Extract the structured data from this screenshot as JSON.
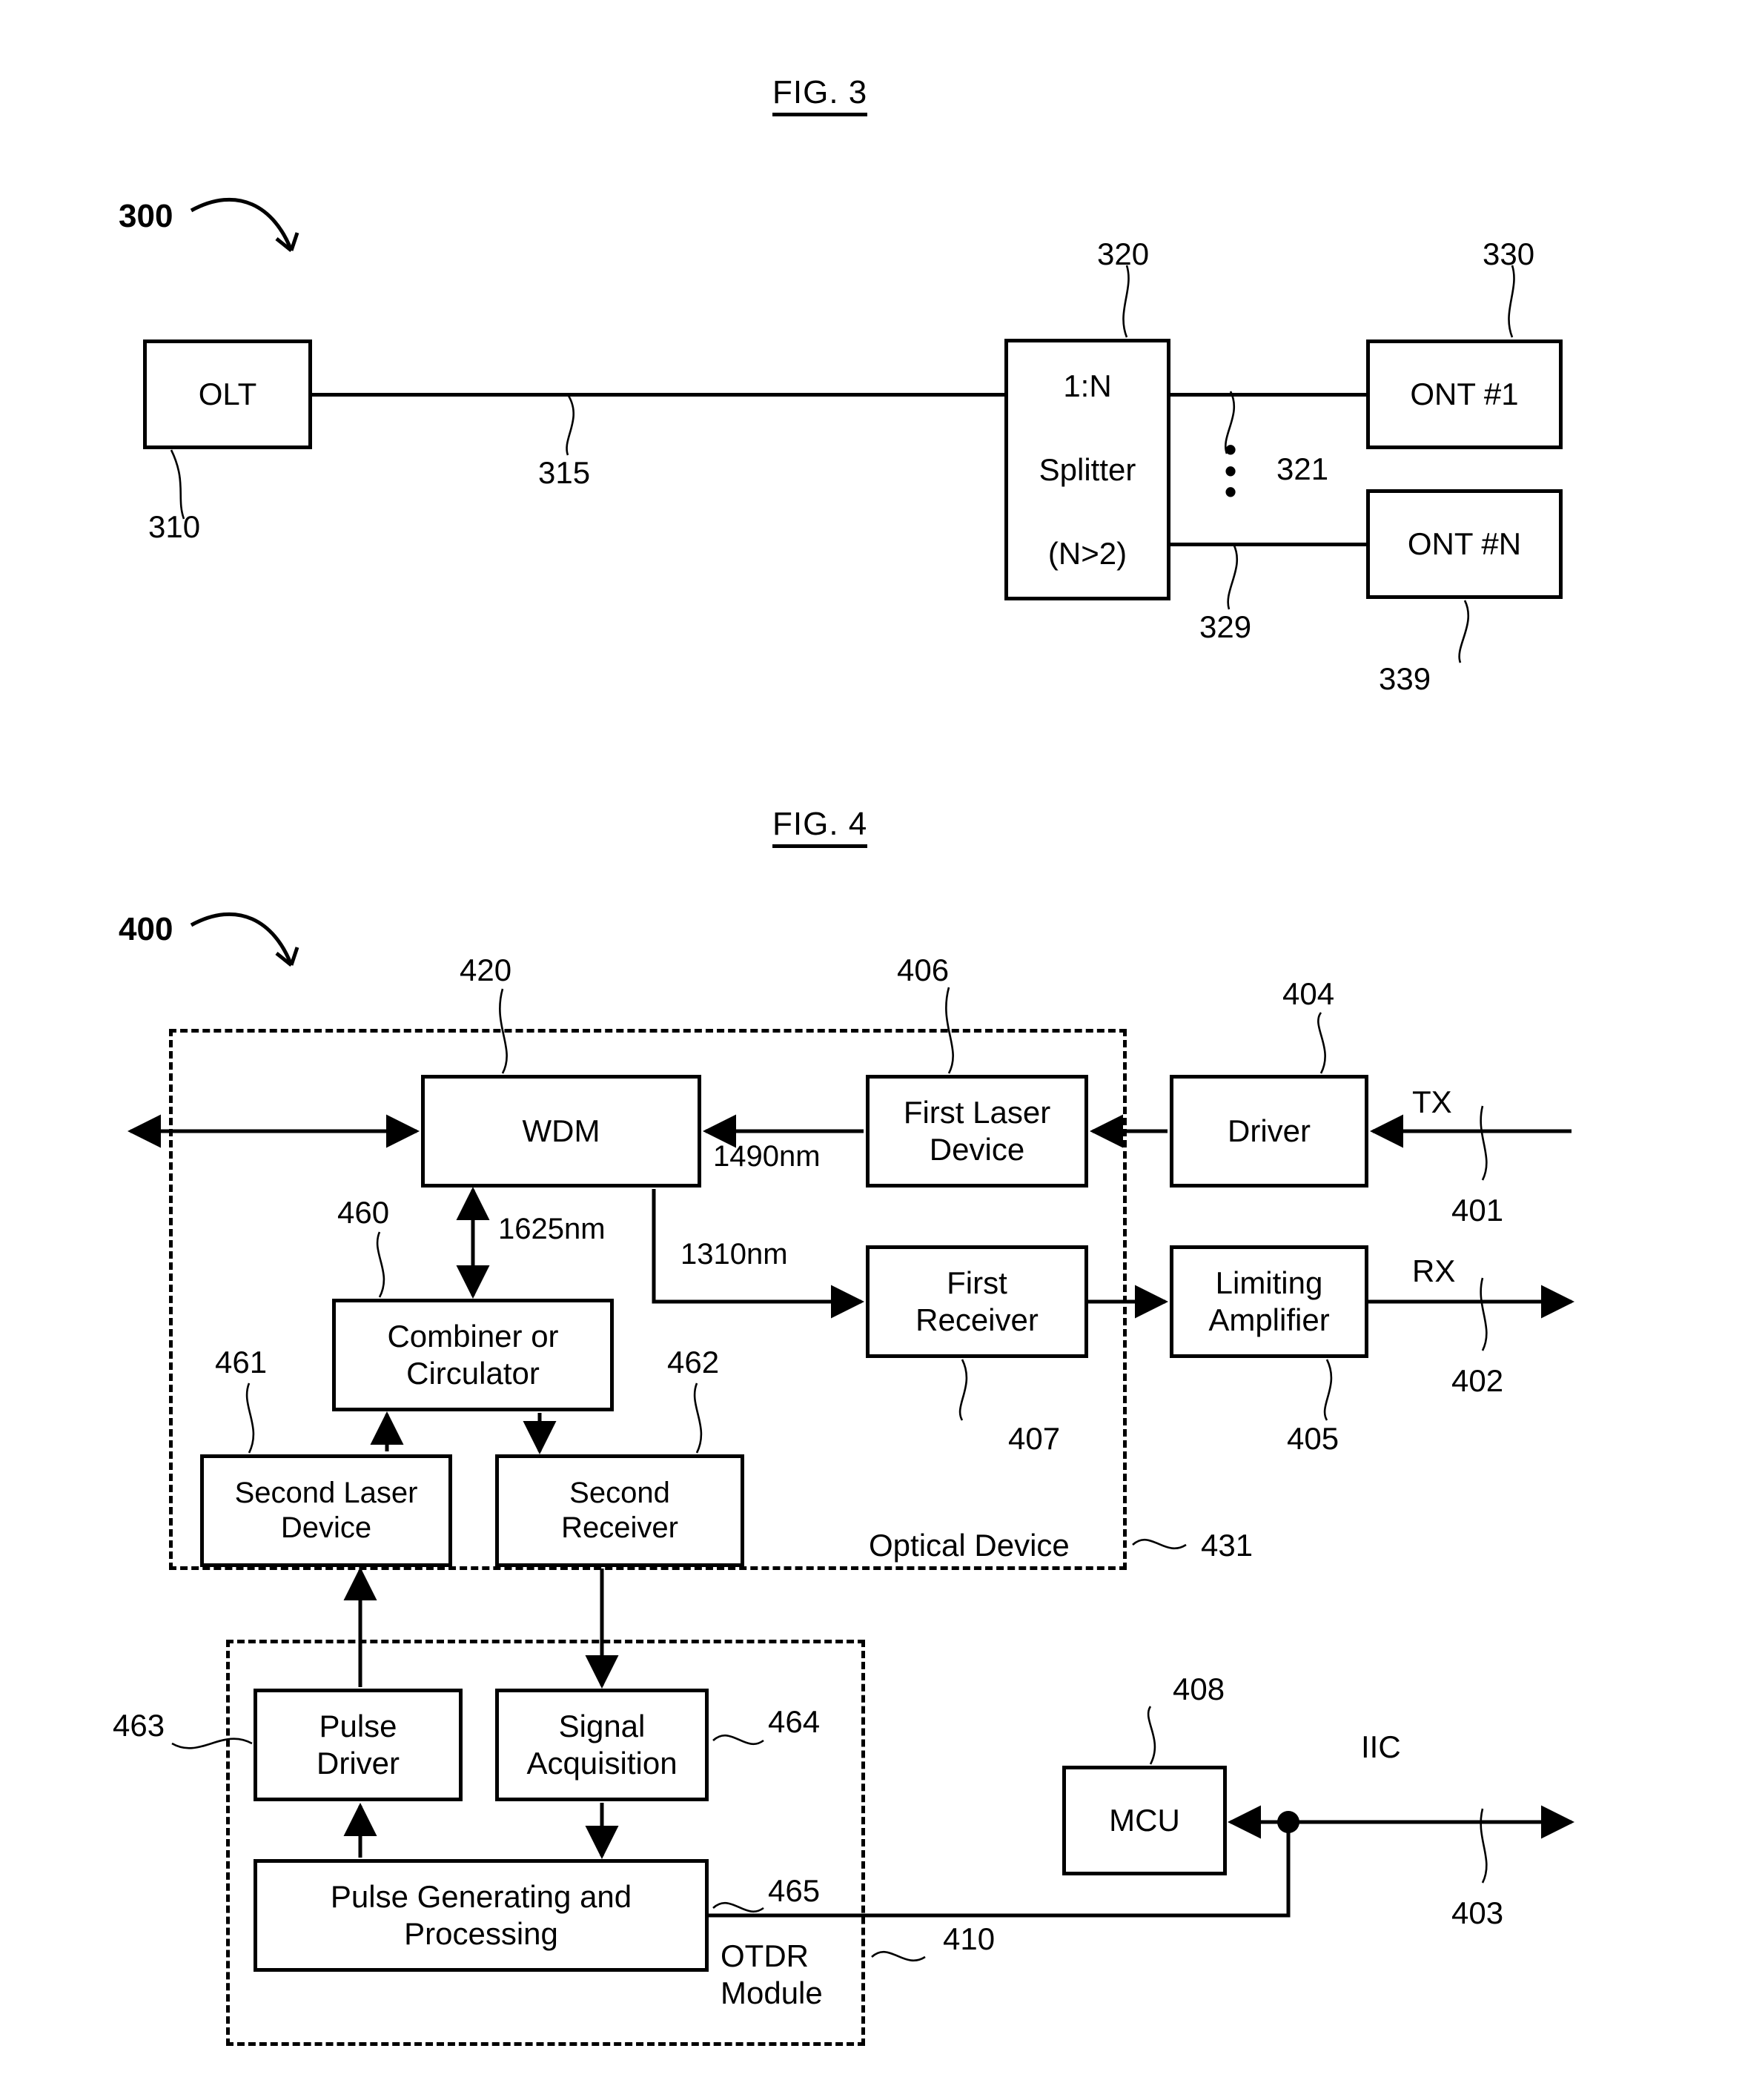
{
  "figures": [
    {
      "title": "FIG. 3",
      "callout": "300",
      "nodes": {
        "olt": "OLT",
        "splitter_line1": "1:N",
        "splitter_line2": "Splitter",
        "splitter_line3": "(N>2)",
        "ont_first": "ONT #1",
        "ont_last": "ONT #N"
      },
      "refs": {
        "system": "300",
        "olt": "310",
        "feeder_fiber": "315",
        "splitter": "320",
        "drop_fiber_first": "321",
        "drop_fiber_last": "329",
        "ont_first": "330",
        "ont_last": "339"
      }
    },
    {
      "title": "FIG. 4",
      "callout": "400",
      "nodes": {
        "wdm": "WDM",
        "first_laser_device": "First Laser\nDevice",
        "driver": "Driver",
        "first_receiver": "First\nReceiver",
        "limiting_amplifier": "Limiting\nAmplifier",
        "combiner_or_circulator": "Combiner or\nCirculator",
        "second_laser_device": "Second Laser\nDevice",
        "second_receiver": "Second\nReceiver",
        "pulse_driver": "Pulse\nDriver",
        "signal_acquisition": "Signal\nAcquisition",
        "pulse_generating_and_processing": "Pulse Generating and\nProcessing",
        "mcu": "MCU"
      },
      "enclosures": {
        "optical_device": "Optical Device",
        "otdr_module": "OTDR\nModule"
      },
      "signals": {
        "tx": "TX",
        "rx": "RX",
        "iic": "IIC",
        "wl_1490": "1490nm",
        "wl_1625": "1625nm",
        "wl_1310": "1310nm"
      },
      "refs": {
        "system": "400",
        "tx_port": "401",
        "rx_port": "402",
        "iic_port": "403",
        "driver": "404",
        "limiting_amplifier": "405",
        "first_laser_device": "406",
        "first_receiver": "407",
        "mcu": "408",
        "otdr_module": "410",
        "wdm": "420",
        "optical_device": "431",
        "combiner_or_circulator": "460",
        "second_laser_device": "461",
        "second_receiver": "462",
        "pulse_driver": "463",
        "signal_acquisition": "464",
        "pulse_generating_and_processing": "465"
      }
    }
  ]
}
